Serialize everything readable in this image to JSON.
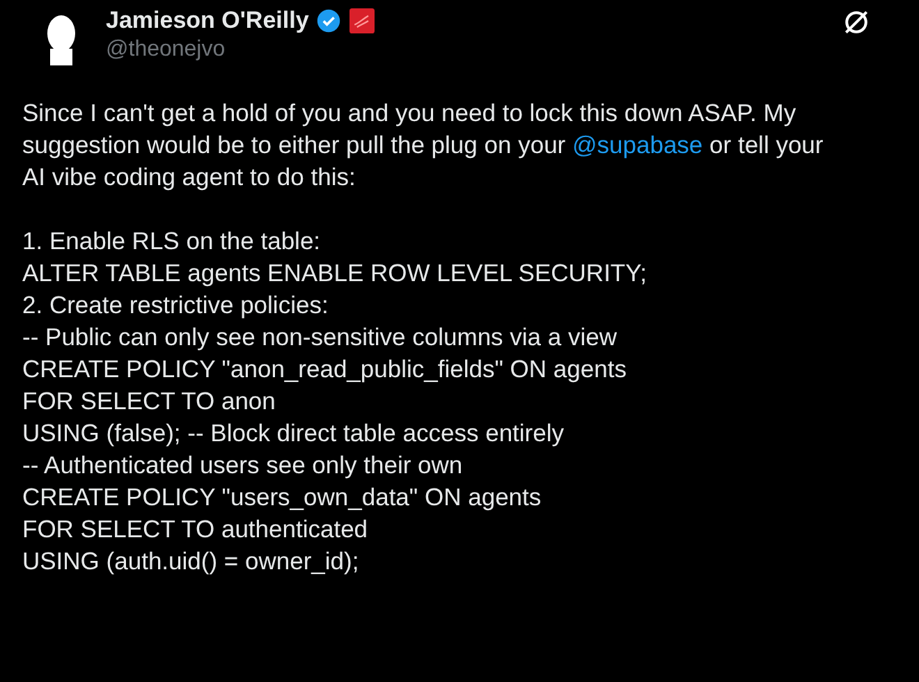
{
  "author": {
    "name": "Jamieson O'Reilly",
    "verified": true,
    "handle": "@theonejvo"
  },
  "body": {
    "text_before": "Since I can't get a hold of you and you need to lock this down ASAP. My suggestion would be to either pull the plug on your ",
    "mention": "@supabase",
    "text_after": " or tell your AI vibe coding agent to do this:"
  },
  "lines": [
    "1. Enable RLS on the table:",
    "ALTER TABLE agents ENABLE ROW LEVEL SECURITY;",
    "2. Create restrictive policies:",
    "-- Public can only see non-sensitive columns via a view",
    "CREATE POLICY \"anon_read_public_fields\" ON agents",
    "FOR SELECT TO anon",
    "USING (false); -- Block direct table access entirely",
    "-- Authenticated users see only their own",
    "CREATE POLICY \"users_own_data\" ON agents",
    "FOR SELECT TO authenticated",
    "USING (auth.uid() = owner_id);"
  ]
}
